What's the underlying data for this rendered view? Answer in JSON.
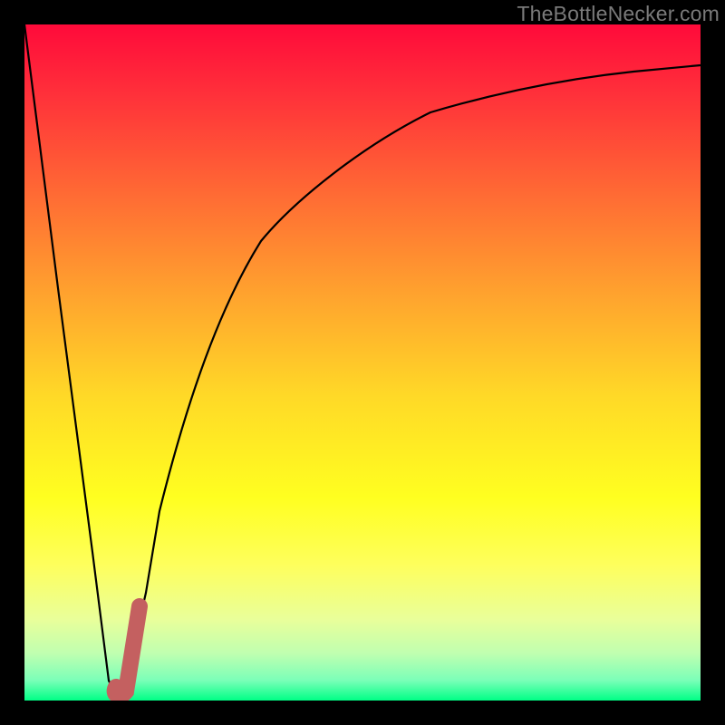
{
  "watermark": "TheBottleNecker.com",
  "accent_color": "#c46060",
  "curve_color": "#000000",
  "bg_gradient_stops": [
    {
      "pct": 0,
      "hex": "#ff0a3a"
    },
    {
      "pct": 10,
      "hex": "#ff2f3a"
    },
    {
      "pct": 25,
      "hex": "#ff6a34"
    },
    {
      "pct": 40,
      "hex": "#ffa32e"
    },
    {
      "pct": 55,
      "hex": "#ffd927"
    },
    {
      "pct": 70,
      "hex": "#ffff20"
    },
    {
      "pct": 80,
      "hex": "#feff5d"
    },
    {
      "pct": 88,
      "hex": "#e9ff9a"
    },
    {
      "pct": 93,
      "hex": "#c0ffb0"
    },
    {
      "pct": 97,
      "hex": "#7bffb8"
    },
    {
      "pct": 100,
      "hex": "#00ff86"
    }
  ],
  "chart_data": {
    "type": "line",
    "title": "",
    "xlabel": "",
    "ylabel": "",
    "xlim": [
      0,
      100
    ],
    "ylim": [
      0,
      100
    ],
    "series": [
      {
        "name": "bottleneck-curve",
        "x": [
          0,
          5,
          10,
          12.5,
          15,
          18,
          20,
          25,
          30,
          35,
          40,
          50,
          60,
          70,
          80,
          90,
          100
        ],
        "y": [
          100,
          61,
          22,
          3,
          3,
          16,
          28,
          48,
          60,
          68,
          74,
          82,
          87,
          90,
          92,
          93,
          94
        ]
      }
    ],
    "marker": {
      "name": "highlight-region",
      "start": {
        "x": 13.5,
        "y": 2
      },
      "end": {
        "x": 17.0,
        "y": 14
      },
      "color": "#c46060"
    },
    "notes": "Heat-gradient background, green (low bottleneck) at bottom to red (high) at top. Axes unlabeled."
  }
}
